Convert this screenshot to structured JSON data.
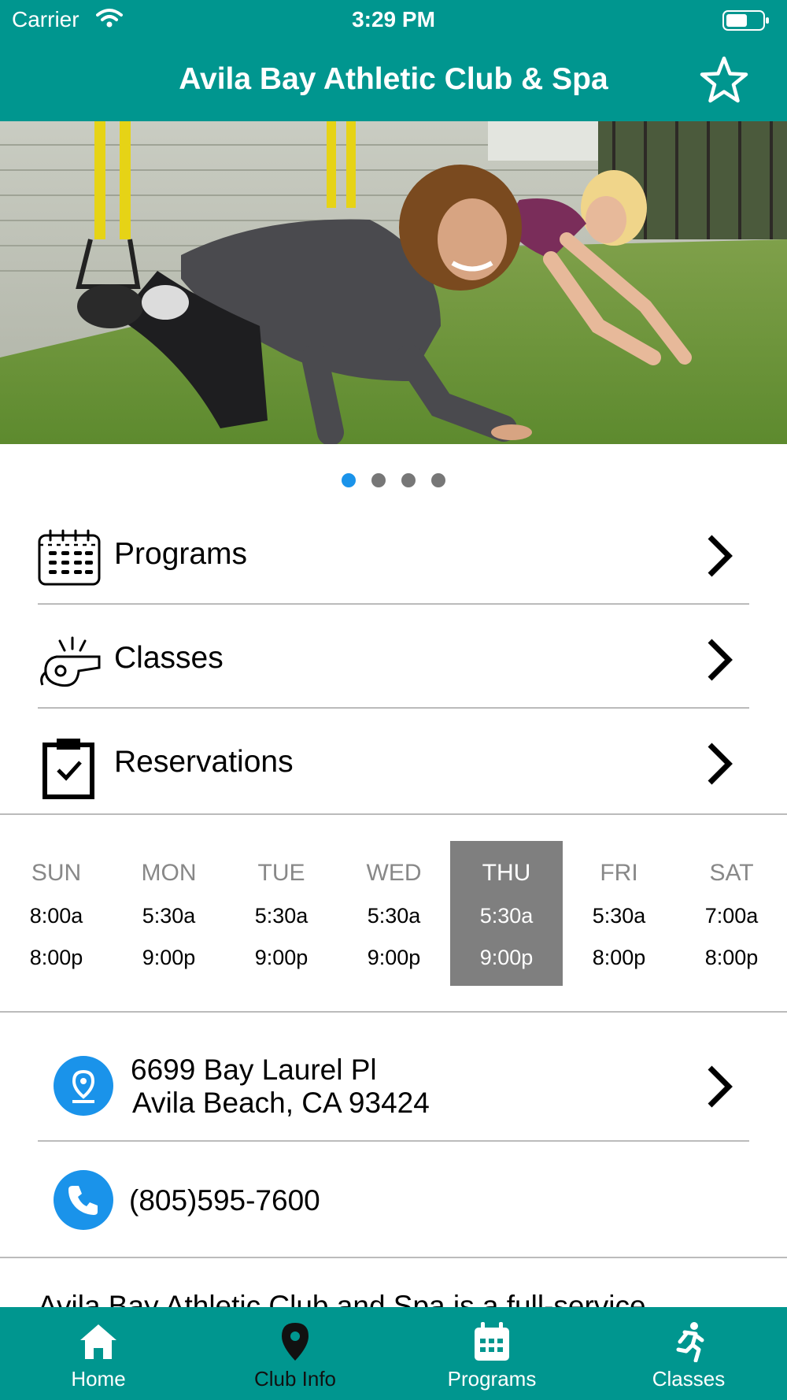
{
  "status_bar": {
    "carrier": "Carrier",
    "time": "3:29 PM"
  },
  "header": {
    "title": "Avila Bay Athletic Club & Spa"
  },
  "carousel": {
    "page_count": 4,
    "active_index": 0
  },
  "menu": {
    "programs_label": "Programs",
    "classes_label": "Classes",
    "reservations_label": "Reservations"
  },
  "hours": {
    "days": [
      {
        "day": "SUN",
        "open": "8:00a",
        "close": "8:00p"
      },
      {
        "day": "MON",
        "open": "5:30a",
        "close": "9:00p"
      },
      {
        "day": "TUE",
        "open": "5:30a",
        "close": "9:00p"
      },
      {
        "day": "WED",
        "open": "5:30a",
        "close": "9:00p"
      },
      {
        "day": "THU",
        "open": "5:30a",
        "close": "9:00p"
      },
      {
        "day": "FRI",
        "open": "5:30a",
        "close": "8:00p"
      },
      {
        "day": "SAT",
        "open": "7:00a",
        "close": "8:00p"
      }
    ],
    "highlighted_day": "THU"
  },
  "contact": {
    "address_line1": "6699 Bay Laurel Pl",
    "address_line2": "Avila Beach, CA 93424",
    "phone": "(805)595-7600"
  },
  "description": "Avila Bay Athletic Club and Spa is a full-service",
  "tab_bar": {
    "home": "Home",
    "club_info": "Club Info",
    "programs": "Programs",
    "classes": "Classes",
    "active": "Club Info"
  },
  "colors": {
    "brand_teal": "#00968f",
    "accent_blue": "#1a93ea",
    "highlight_gray": "#7f7f7f"
  },
  "icons": {
    "status": [
      "wifi-icon",
      "battery-icon"
    ],
    "header": "star-icon",
    "menu": [
      "calendar-icon",
      "whistle-icon",
      "clipboard-check-icon",
      "chevron-right-icon"
    ],
    "contact": [
      "location-pin-icon",
      "phone-icon"
    ],
    "tabs": [
      "home-icon",
      "map-pin-icon",
      "calendar-icon",
      "runner-icon"
    ]
  }
}
